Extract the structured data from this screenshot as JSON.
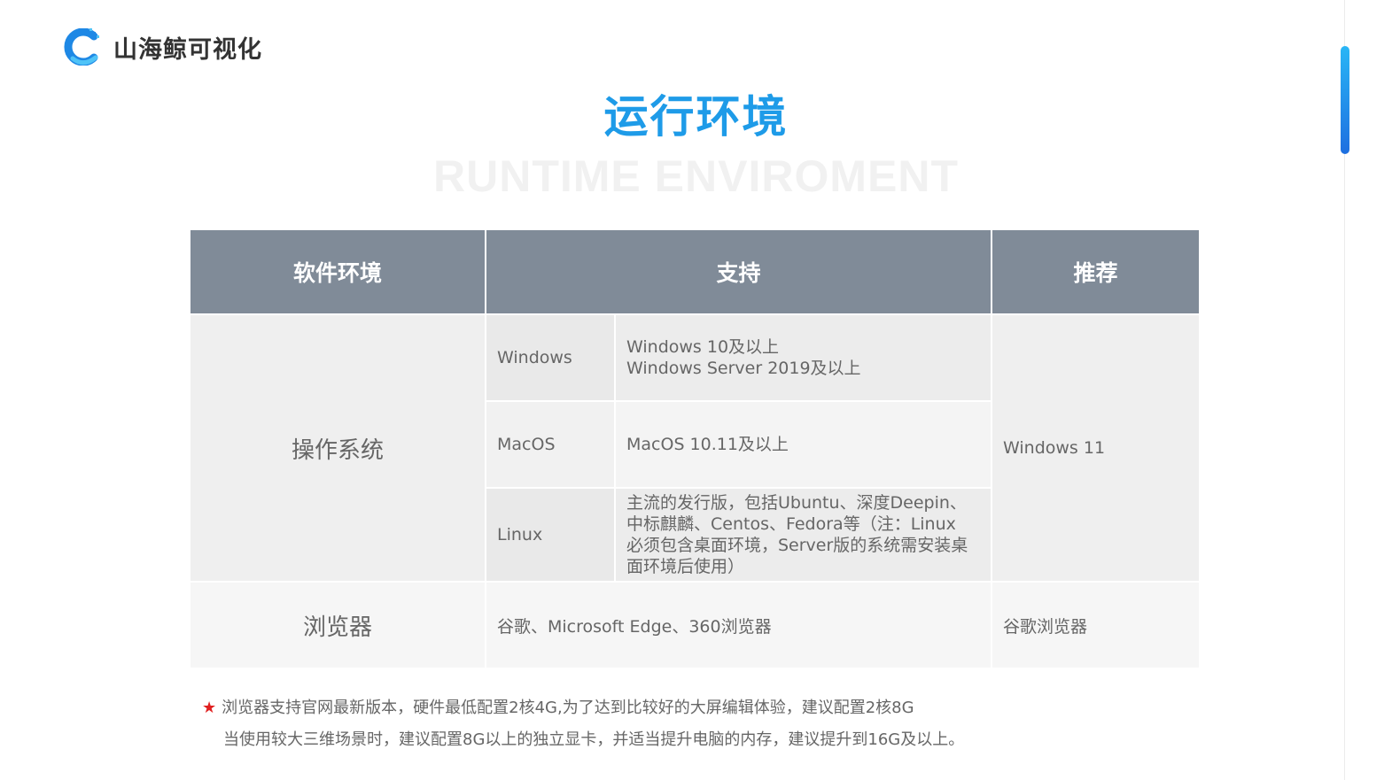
{
  "brand": {
    "name": "山海鲸可视化"
  },
  "page": {
    "title": "运行环境",
    "subtitle": "RUNTIME ENVIROMENT"
  },
  "table": {
    "headers": [
      "软件环境",
      "支持",
      "推荐"
    ],
    "os": {
      "category": "操作系统",
      "recommend": "Windows 11",
      "rows": [
        {
          "name": "Windows",
          "versions": [
            "Windows 10及以上",
            "Windows Server 2019及以上"
          ]
        },
        {
          "name": "MacOS",
          "versions": [
            "MacOS 10.11及以上"
          ]
        },
        {
          "name": "Linux",
          "versions": [
            "主流的发行版，包括Ubuntu、深度Deepin、",
            "中标麒麟、Centos、Fedora等（注：Linux",
            "必须包含桌面环境，Server版的系统需安装桌",
            "面环境后使用）"
          ]
        }
      ]
    },
    "browser": {
      "category": "浏览器",
      "support": "谷歌、Microsoft Edge、360浏览器",
      "recommend": "谷歌浏览器"
    }
  },
  "notes": {
    "star": "★",
    "line1": "浏览器支持官网最新版本，硬件最低配置2核4G,为了达到比较好的大屏编辑体验，建议配置2核8G",
    "line2": "当使用较大三维场景时，建议配置8G以上的独立显卡，并适当提升电脑的内存，建议提升到16G及以上。"
  },
  "colors": {
    "accent": "#1e9be8",
    "header_bg": "#808b98",
    "star": "#e02020"
  },
  "icons": {
    "logo": "whale-c-logo-icon"
  }
}
